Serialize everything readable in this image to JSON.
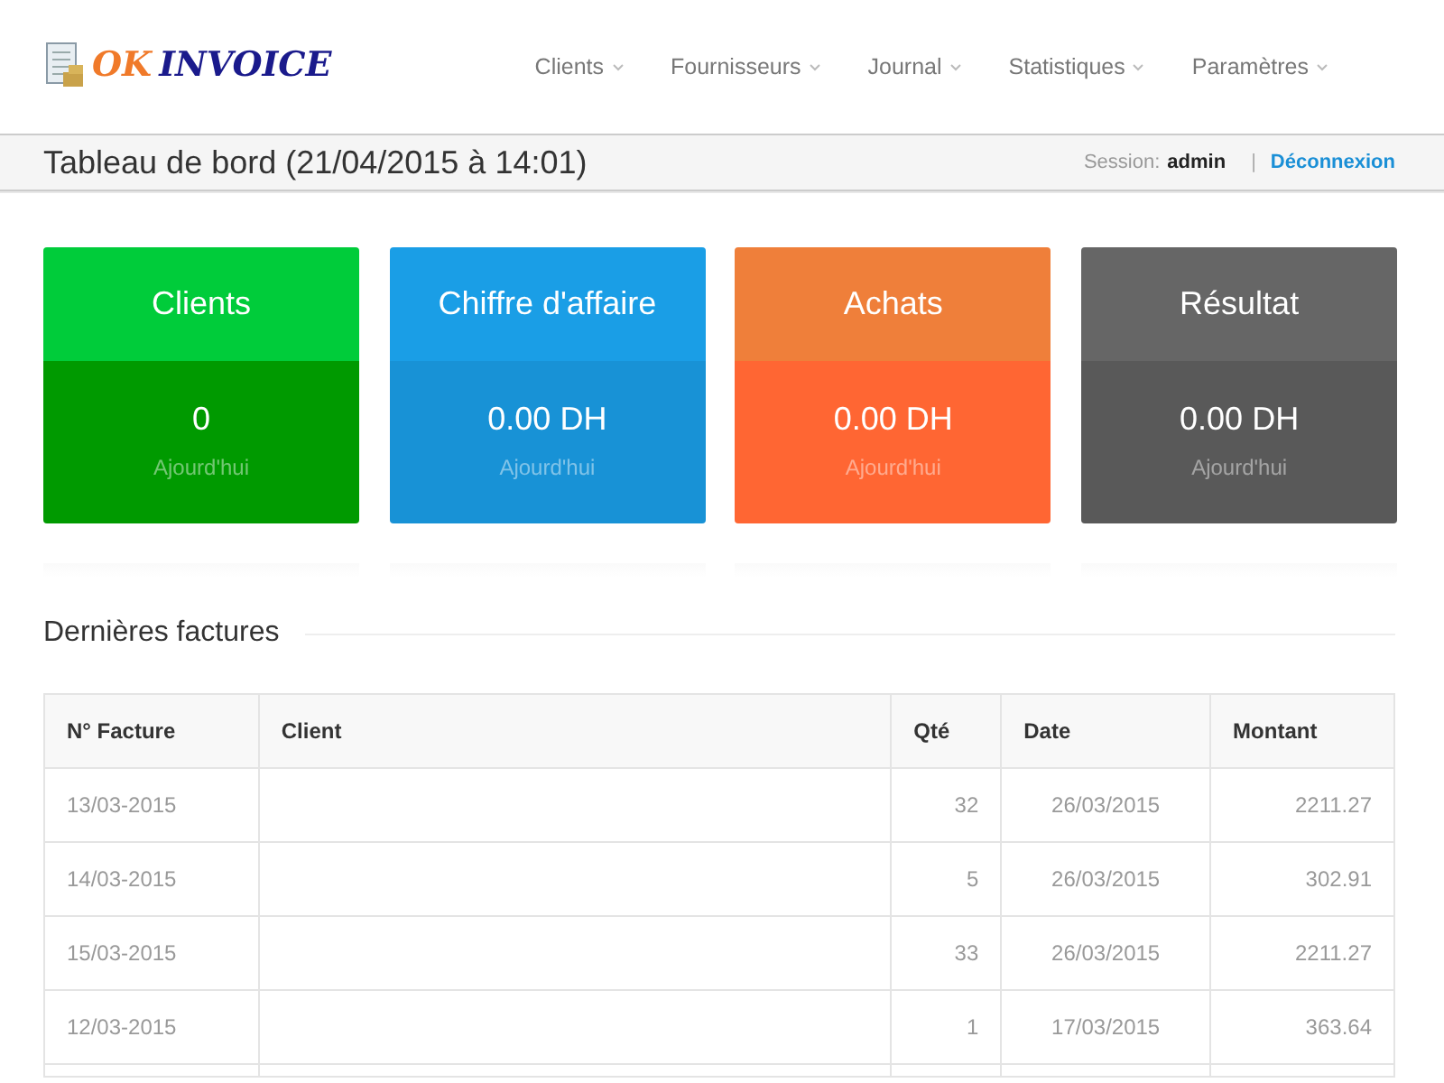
{
  "logo": {
    "part_1": "OK",
    "part_2": "INVOICE"
  },
  "nav": [
    {
      "label": "Clients"
    },
    {
      "label": "Fournisseurs"
    },
    {
      "label": "Journal"
    },
    {
      "label": "Statistiques"
    },
    {
      "label": "Paramètres"
    }
  ],
  "page_bar": {
    "title": "Tableau de bord (21/04/2015 à 14:01)",
    "session_label": "Session:",
    "user": "admin",
    "separator": "|",
    "logout": "Déconnexion"
  },
  "cards": [
    {
      "title": "Clients",
      "color": "#00cc3a",
      "body": {
        "value": "0",
        "caption": "Ajourd'hui",
        "color": "#009a00"
      }
    },
    {
      "title": "Chiffre d'affaire",
      "color": "#1a9ee6",
      "body": {
        "value": "0.00 DH",
        "caption": "Ajourd'hui",
        "color": "#1892d6"
      }
    },
    {
      "title": "Achats",
      "color": "#ef7f3a",
      "body": {
        "value": "0.00 DH",
        "caption": "Ajourd'hui",
        "color": "#ff6633"
      }
    },
    {
      "title": "Résultat",
      "color": "#666666",
      "body": {
        "value": "0.00 DH",
        "caption": "Ajourd'hui",
        "color": "#595959"
      }
    }
  ],
  "section_title": "Dernières factures",
  "table": {
    "columns": [
      "N° Facture",
      "Client",
      "Qté",
      "Date",
      "Montant"
    ],
    "rows": [
      [
        "13/03-2015",
        "",
        "32",
        "26/03/2015",
        "2211.27"
      ],
      [
        "14/03-2015",
        "",
        "5",
        "26/03/2015",
        "302.91"
      ],
      [
        "15/03-2015",
        "",
        "33",
        "26/03/2015",
        "2211.27"
      ],
      [
        "12/03-2015",
        "",
        "1",
        "17/03/2015",
        "363.64"
      ]
    ]
  }
}
